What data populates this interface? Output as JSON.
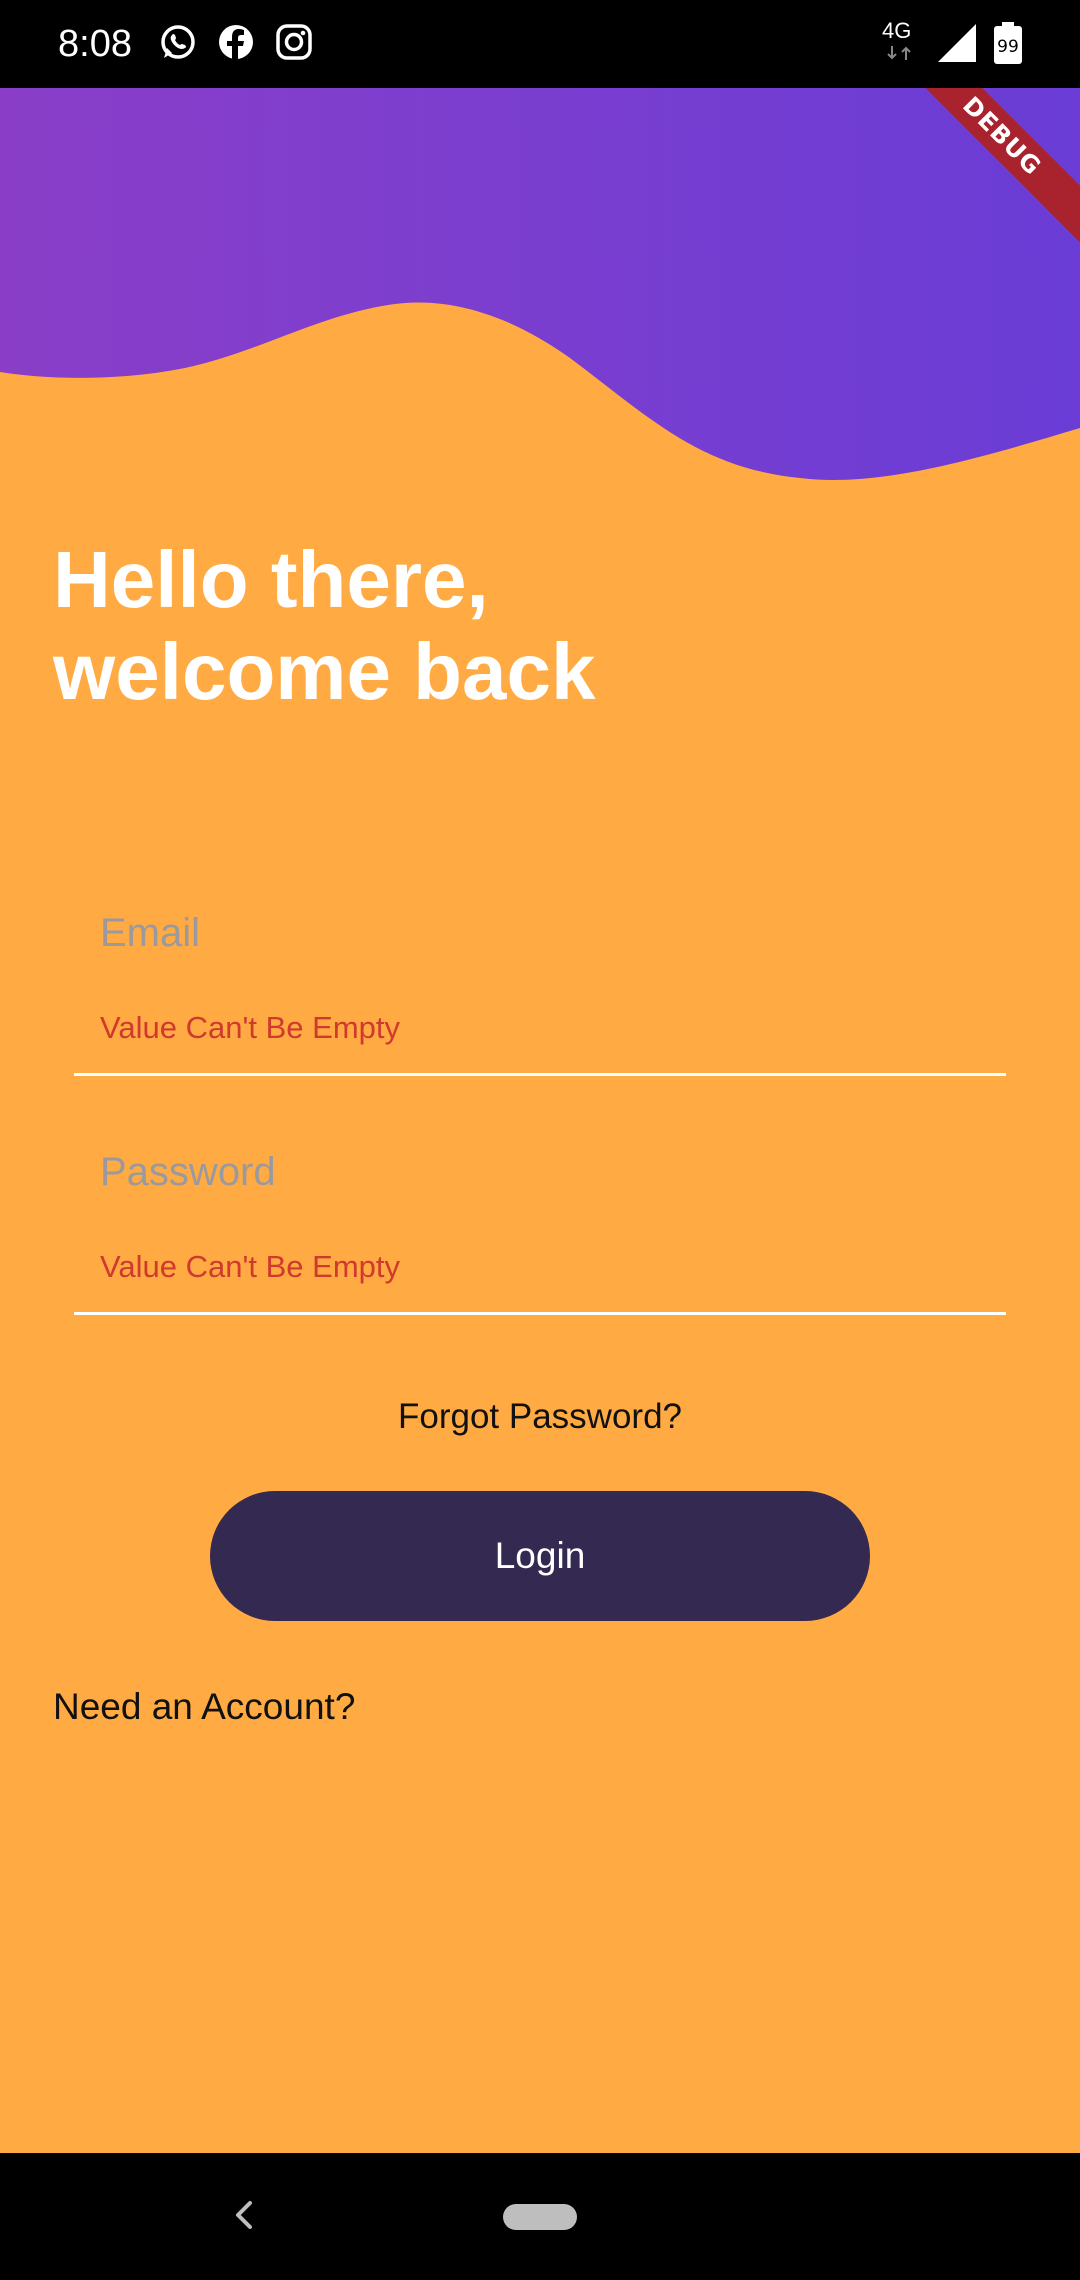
{
  "status_bar": {
    "time": "8:08",
    "notification_icons": [
      "whatsapp-icon",
      "facebook-icon",
      "instagram-icon"
    ],
    "network": "4G",
    "battery_level": "99"
  },
  "debug_banner": "DEBUG",
  "header": {
    "greeting_line1": "Hello there,",
    "greeting_line2": "welcome back"
  },
  "form": {
    "email": {
      "placeholder": "Email",
      "value": "",
      "error": "Value Can't Be Empty"
    },
    "password": {
      "placeholder": "Password",
      "value": "",
      "error": "Value Can't Be Empty"
    },
    "forgot_password_label": "Forgot Password?",
    "login_label": "Login",
    "need_account_label": "Need an Account?"
  },
  "colors": {
    "background": "#FFAA42",
    "wave_start": "#8A3EC8",
    "wave_end": "#6A3DD6",
    "button": "#332951",
    "error": "#D03A2E",
    "debug_banner": "#A8232E"
  },
  "nav_bar": {
    "icons": [
      "back-icon",
      "home-pill"
    ]
  }
}
